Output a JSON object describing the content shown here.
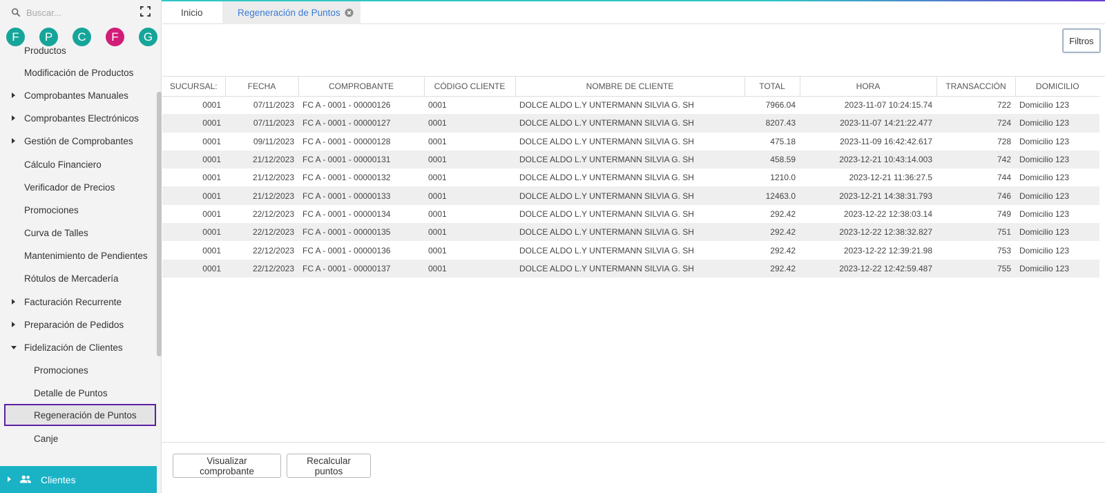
{
  "search": {
    "placeholder": "Buscar..."
  },
  "avatars": [
    {
      "letter": "F",
      "color": "#16a59a"
    },
    {
      "letter": "P",
      "color": "#16a59a"
    },
    {
      "letter": "C",
      "color": "#16a59a"
    },
    {
      "letter": "F",
      "color": "#d11d78"
    },
    {
      "letter": "G",
      "color": "#16a59a"
    }
  ],
  "sidebar": {
    "items": [
      {
        "label": "Productos",
        "arrow": "none",
        "sub": false
      },
      {
        "label": "Modificación de Productos",
        "arrow": "none",
        "sub": false
      },
      {
        "label": "Comprobantes Manuales",
        "arrow": "right",
        "sub": false
      },
      {
        "label": "Comprobantes Electrónicos",
        "arrow": "right",
        "sub": false
      },
      {
        "label": "Gestión de Comprobantes",
        "arrow": "right",
        "sub": false
      },
      {
        "label": "Cálculo Financiero",
        "arrow": "none",
        "sub": false
      },
      {
        "label": "Verificador de Precios",
        "arrow": "none",
        "sub": false
      },
      {
        "label": "Promociones",
        "arrow": "none",
        "sub": false
      },
      {
        "label": "Curva de Talles",
        "arrow": "none",
        "sub": false
      },
      {
        "label": "Mantenimiento de Pendientes",
        "arrow": "none",
        "sub": false
      },
      {
        "label": "Rótulos de Mercadería",
        "arrow": "none",
        "sub": false
      },
      {
        "label": "Facturación Recurrente",
        "arrow": "right",
        "sub": false
      },
      {
        "label": "Preparación de Pedidos",
        "arrow": "right",
        "sub": false
      },
      {
        "label": "Fidelización de Clientes",
        "arrow": "down",
        "sub": false
      },
      {
        "label": "Promociones",
        "arrow": "none",
        "sub": true
      },
      {
        "label": "Detalle de Puntos",
        "arrow": "none",
        "sub": true
      },
      {
        "label": "Regeneración de Puntos",
        "arrow": "none",
        "sub": true,
        "selected": true
      },
      {
        "label": "Canje",
        "arrow": "none",
        "sub": true
      }
    ],
    "bottom_section": "Clientes"
  },
  "tabs": [
    {
      "label": "Inicio",
      "active": false
    },
    {
      "label": "Regeneración de Puntos",
      "active": true
    }
  ],
  "filters_label": "Filtros",
  "table": {
    "columns": [
      "SUCURSAL:",
      "FECHA",
      "COMPROBANTE",
      "CÓDIGO CLIENTE",
      "NOMBRE DE CLIENTE",
      "TOTAL",
      "HORA",
      "TRANSACCIÓN",
      "DOMICILIO"
    ],
    "rows": [
      [
        "0001",
        "07/11/2023",
        "FC A - 0001 - 00000126",
        "0001",
        "DOLCE ALDO L.Y UNTERMANN SILVIA G. SH",
        "7966.04",
        "2023-11-07 10:24:15.74",
        "722",
        "Domicilio 123"
      ],
      [
        "0001",
        "07/11/2023",
        "FC A - 0001 - 00000127",
        "0001",
        "DOLCE ALDO L.Y UNTERMANN SILVIA G. SH",
        "8207.43",
        "2023-11-07 14:21:22.477",
        "724",
        "Domicilio 123"
      ],
      [
        "0001",
        "09/11/2023",
        "FC A - 0001 - 00000128",
        "0001",
        "DOLCE ALDO L.Y UNTERMANN SILVIA G. SH",
        "475.18",
        "2023-11-09 16:42:42.617",
        "728",
        "Domicilio 123"
      ],
      [
        "0001",
        "21/12/2023",
        "FC A - 0001 - 00000131",
        "0001",
        "DOLCE ALDO L.Y UNTERMANN SILVIA G. SH",
        "458.59",
        "2023-12-21 10:43:14.003",
        "742",
        "Domicilio 123"
      ],
      [
        "0001",
        "21/12/2023",
        "FC A - 0001 - 00000132",
        "0001",
        "DOLCE ALDO L.Y UNTERMANN SILVIA G. SH",
        "1210.0",
        "2023-12-21 11:36:27.5",
        "744",
        "Domicilio 123"
      ],
      [
        "0001",
        "21/12/2023",
        "FC A - 0001 - 00000133",
        "0001",
        "DOLCE ALDO L.Y UNTERMANN SILVIA G. SH",
        "12463.0",
        "2023-12-21 14:38:31.793",
        "746",
        "Domicilio 123"
      ],
      [
        "0001",
        "22/12/2023",
        "FC A - 0001 - 00000134",
        "0001",
        "DOLCE ALDO L.Y UNTERMANN SILVIA G. SH",
        "292.42",
        "2023-12-22 12:38:03.14",
        "749",
        "Domicilio 123"
      ],
      [
        "0001",
        "22/12/2023",
        "FC A - 0001 - 00000135",
        "0001",
        "DOLCE ALDO L.Y UNTERMANN SILVIA G. SH",
        "292.42",
        "2023-12-22 12:38:32.827",
        "751",
        "Domicilio 123"
      ],
      [
        "0001",
        "22/12/2023",
        "FC A - 0001 - 00000136",
        "0001",
        "DOLCE ALDO L.Y UNTERMANN SILVIA G. SH",
        "292.42",
        "2023-12-22 12:39:21.98",
        "753",
        "Domicilio 123"
      ],
      [
        "0001",
        "22/12/2023",
        "FC A - 0001 - 00000137",
        "0001",
        "DOLCE ALDO L.Y UNTERMANN SILVIA G. SH",
        "292.42",
        "2023-12-22 12:42:59.487",
        "755",
        "Domicilio 123"
      ]
    ]
  },
  "actions": {
    "view_label": "Visualizar comprobante",
    "recalc_label": "Recalcular puntos"
  },
  "colors": {
    "accent": "#1ab3c6",
    "selected_border": "#5a1fa0",
    "active_tab_text": "#3a7bd5"
  }
}
